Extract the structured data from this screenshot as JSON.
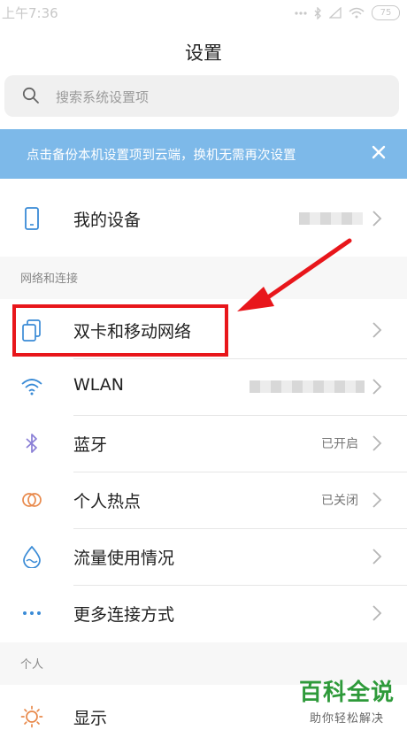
{
  "status_bar": {
    "time": "上午7:36",
    "battery": "75"
  },
  "header": {
    "title": "设置"
  },
  "search": {
    "placeholder": "搜索系统设置项"
  },
  "banner": {
    "text": "点击备份本机设置项到云端，换机无需再次设置"
  },
  "my_device": {
    "label": "我的设备",
    "icon": "phone-icon"
  },
  "network_section": {
    "title": "网络和连接",
    "items": [
      {
        "label": "双卡和移动网络",
        "value": "",
        "icon": "sim-card-icon"
      },
      {
        "label": "WLAN",
        "value": "",
        "icon": "wifi-icon"
      },
      {
        "label": "蓝牙",
        "value": "已开启",
        "icon": "bluetooth-icon"
      },
      {
        "label": "个人热点",
        "value": "已关闭",
        "icon": "hotspot-icon"
      },
      {
        "label": "流量使用情况",
        "value": "",
        "icon": "data-usage-icon"
      },
      {
        "label": "更多连接方式",
        "value": "",
        "icon": "more-icon"
      }
    ]
  },
  "personal_section": {
    "title": "个人",
    "items": [
      {
        "label": "显示",
        "icon": "display-brightness-icon"
      }
    ]
  },
  "watermark": {
    "main": "百科全说",
    "sub": "助你轻松解决"
  },
  "colors": {
    "banner": "#7db9e9",
    "highlight": "#e8161b",
    "icon_blue": "#3a8bd6"
  }
}
